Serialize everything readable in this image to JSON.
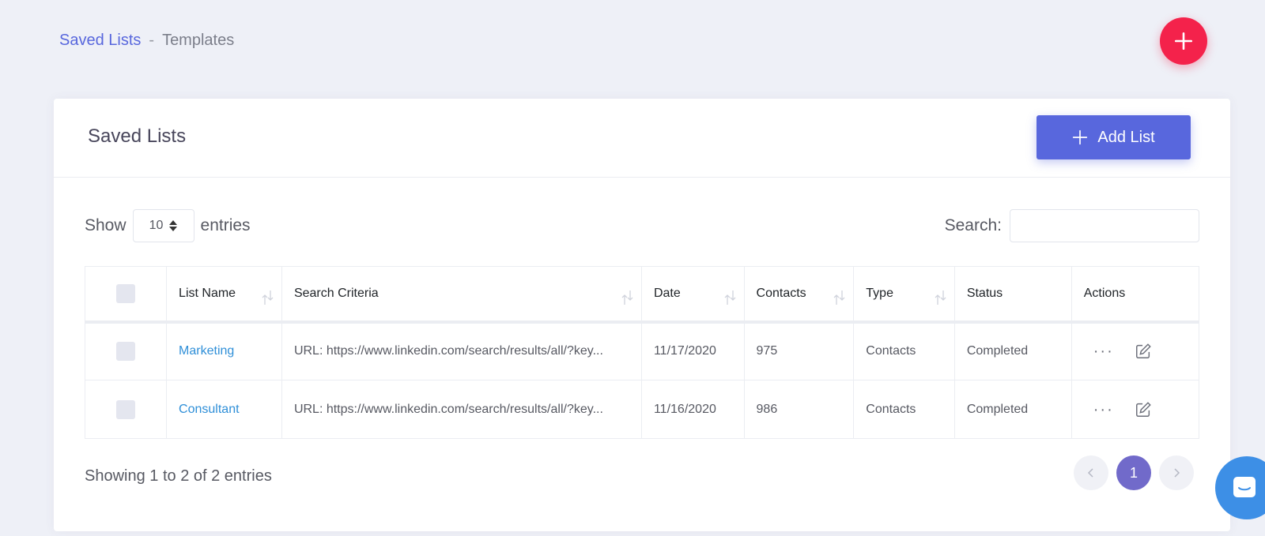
{
  "breadcrumb": {
    "link": "Saved Lists",
    "separator": "-",
    "current": "Templates"
  },
  "card": {
    "title": "Saved Lists",
    "add_button_label": "Add List"
  },
  "controls": {
    "show_label": "Show",
    "page_size": "10",
    "entries_label": "entries",
    "search_label": "Search:",
    "search_value": ""
  },
  "table": {
    "headers": [
      "List Name",
      "Search Criteria",
      "Date",
      "Contacts",
      "Type",
      "Status",
      "Actions"
    ],
    "rows": [
      {
        "name": "Marketing",
        "criteria": "URL: https://www.linkedin.com/search/results/all/?key...",
        "date": "11/17/2020",
        "contacts": "975",
        "type": "Contacts",
        "status": "Completed"
      },
      {
        "name": "Consultant",
        "criteria": "URL: https://www.linkedin.com/search/results/all/?key...",
        "date": "11/16/2020",
        "contacts": "986",
        "type": "Contacts",
        "status": "Completed"
      }
    ],
    "actions_more": "···"
  },
  "footer": {
    "info": "Showing 1 to 2 of 2 entries",
    "current_page": "1"
  },
  "colors": {
    "accent": "#5867dd",
    "fab": "#f4224b",
    "link": "#2f8fd8",
    "page_active": "#716aca",
    "chat": "#3d8fe6"
  }
}
